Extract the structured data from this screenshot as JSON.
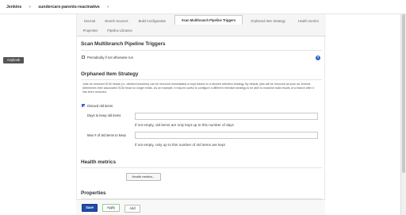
{
  "breadcrumb": {
    "items": [
      "Jenkins",
      "sundercare-parents-reactnative"
    ],
    "separator": "›"
  },
  "back_badge": "Anybook",
  "tabs": [
    {
      "label": "General",
      "active": false
    },
    {
      "label": "Branch Sources",
      "active": false
    },
    {
      "label": "Build Configuration",
      "active": false
    },
    {
      "label": "Scan Multibranch Pipeline Triggers",
      "active": true
    },
    {
      "label": "Orphaned Item Strategy",
      "active": false
    },
    {
      "label": "Health metrics",
      "active": false
    },
    {
      "label": "Properties",
      "active": false
    },
    {
      "label": "Pipeline Libraries",
      "active": false
    }
  ],
  "scan_triggers": {
    "title": "Scan Multibranch Pipeline Triggers",
    "periodic_label": "Periodically if not otherwise run",
    "periodic_checked": false,
    "help_icon": "?"
  },
  "orphaned": {
    "title": "Orphaned Item Strategy",
    "description": "Jobs for removed SCM heads (i.e. deleted branches) can be removed immediately or kept based on a desired retention strategy. By default, jobs will be removed as soon as Jenkins determines their associated SCM head no longer exists. As an example, it may be useful to configure a different retention strategy to be able to examine build results of a branch after it has been removed.",
    "discard_label": "Discard old items",
    "discard_checked": true,
    "days_label": "Days to keep old items",
    "days_value": "",
    "days_hint": "if not empty, old items are only kept up to this number of days",
    "max_label": "Max # of old items to keep",
    "max_value": "",
    "max_hint": "if not empty, only up to this number of old items are kept"
  },
  "health": {
    "title": "Health metrics",
    "button_label": "Health metrics..."
  },
  "properties": {
    "title": "Properties"
  },
  "actions": {
    "save": "Save",
    "apply": "Apply",
    "add": "Add"
  },
  "colors": {
    "accent": "#1f4aa8",
    "checkbox": "#2a62c9"
  }
}
